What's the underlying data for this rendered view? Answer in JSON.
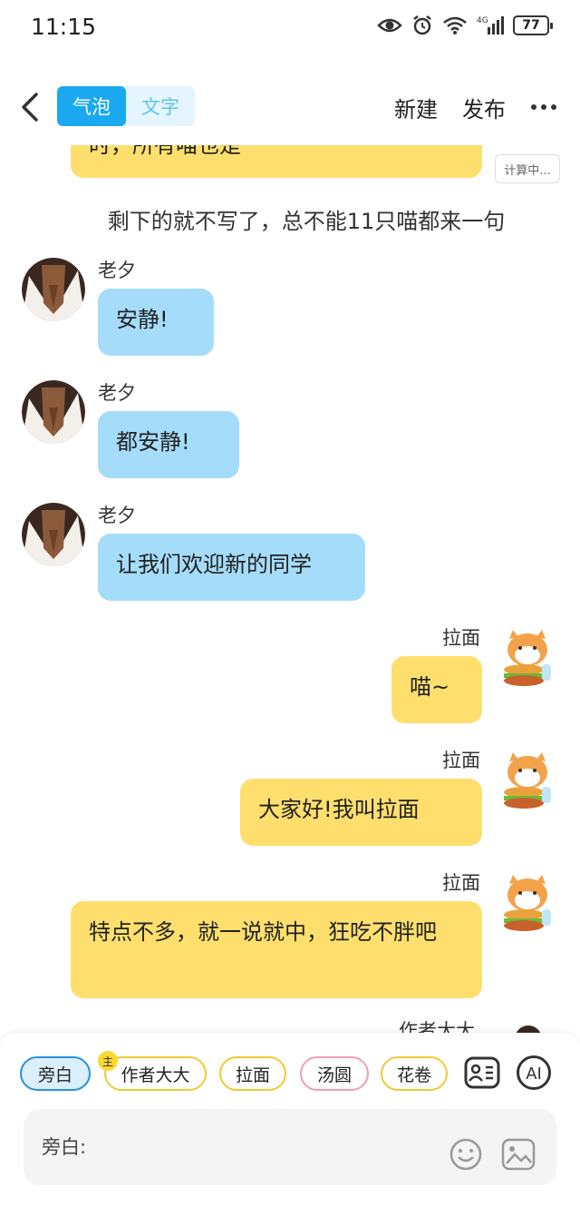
{
  "status": {
    "time": "11:15",
    "battery": "77",
    "network": "4G"
  },
  "header": {
    "seg_bubble": "气泡",
    "seg_text": "文字",
    "new_label": "新建",
    "publish_label": "发布"
  },
  "calc_badge": "计算中...",
  "messages": {
    "top_partial": "时，所有喵也是",
    "narration": "剩下的就不写了，总不能11只喵都来一句",
    "laoxi_name": "老夕",
    "m1": "安静!",
    "m2": "都安静!",
    "m3": "让我们欢迎新的同学",
    "lamian_name": "拉面",
    "m4": "喵~",
    "m5": "大家好!我叫拉面",
    "m6": "特点不多，就一说就中，狂吃不胖吧",
    "partial_author": "作者大大"
  },
  "roles": {
    "narration": "旁白",
    "author": "作者大大",
    "author_badge": "主",
    "lamian": "拉面",
    "tangyuan": "汤圆",
    "huajuan": "花卷"
  },
  "input": {
    "placeholder": "旁白:"
  },
  "colors": {
    "accent": "#1aa9f0",
    "bubble_blue": "#a5dcfa",
    "bubble_yellow": "#fedf6e"
  },
  "icons": [
    "eye-icon",
    "alarm-icon",
    "wifi-icon",
    "signal-icon",
    "battery-icon",
    "back-arrow-icon",
    "more-icon",
    "role-card-icon",
    "ai-icon",
    "emoji-icon",
    "image-icon"
  ]
}
